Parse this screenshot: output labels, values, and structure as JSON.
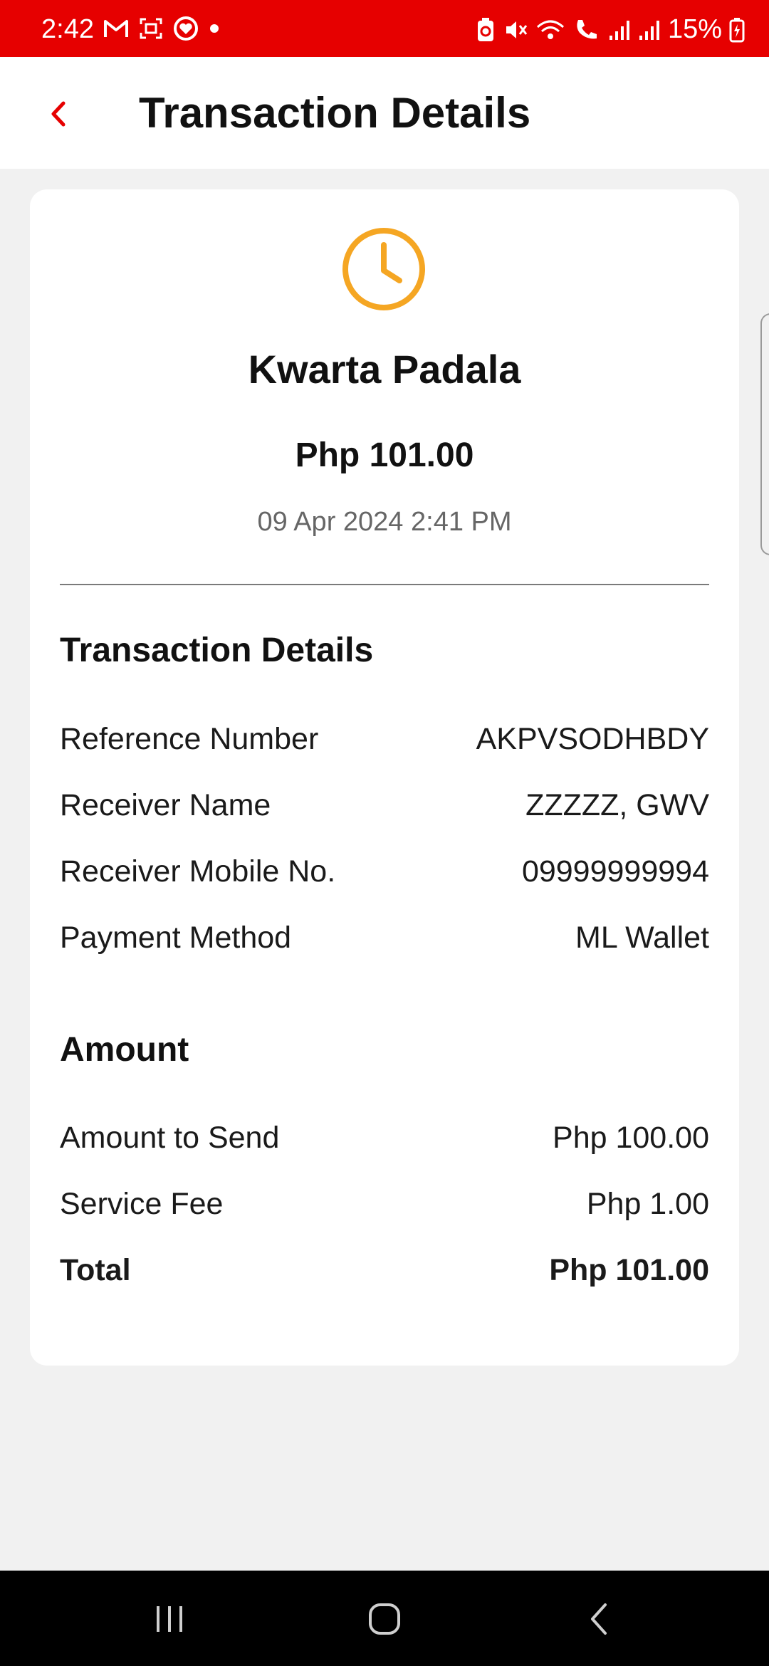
{
  "status_bar": {
    "time": "2:42",
    "battery_percent": "15%",
    "left_icons": [
      "gmail-icon",
      "screenshot-icon",
      "health-icon",
      "dot-icon"
    ],
    "right_icons": [
      "battery-saver-icon",
      "mute-icon",
      "wifi-calling-icon",
      "wifi-call-icon",
      "signal-icon",
      "signal-icon",
      "battery-charging-icon"
    ]
  },
  "header": {
    "title": "Transaction Details",
    "back_icon": "chevron-left-icon"
  },
  "summary": {
    "status_icon": "clock-icon",
    "service_name": "Kwarta Padala",
    "amount": "Php 101.00",
    "datetime": "09 Apr 2024 2:41 PM"
  },
  "details": {
    "title": "Transaction Details",
    "rows": [
      {
        "label": "Reference Number",
        "value": "AKPVSODHBDY"
      },
      {
        "label": "Receiver Name",
        "value": "ZZZZZ, GWV"
      },
      {
        "label": "Receiver Mobile No.",
        "value": "09999999994"
      },
      {
        "label": "Payment Method",
        "value": "ML Wallet"
      }
    ]
  },
  "amount_section": {
    "title": "Amount",
    "rows": [
      {
        "label": "Amount to Send",
        "value": "Php 100.00"
      },
      {
        "label": "Service Fee",
        "value": "Php 1.00"
      },
      {
        "label": "Total",
        "value": "Php 101.00"
      }
    ]
  },
  "colors": {
    "brand_red": "#e60000",
    "clock_amber": "#f5a623",
    "background": "#f1f1f1",
    "card": "#ffffff"
  },
  "nav_bar": {
    "icons": [
      "recent-apps-icon",
      "home-icon",
      "back-icon"
    ]
  }
}
